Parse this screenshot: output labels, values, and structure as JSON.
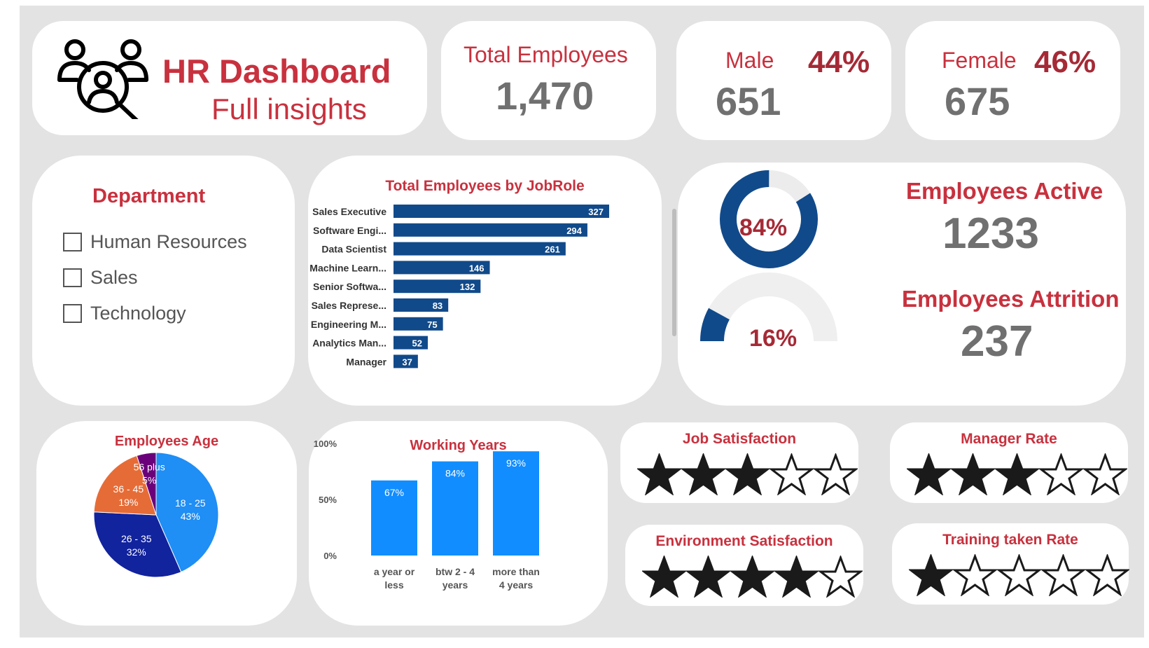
{
  "header": {
    "title": "HR Dashboard",
    "subtitle": "Full insights",
    "logo_icon": "team-search-icon"
  },
  "kpis": {
    "total": {
      "label": "Total Employees",
      "value": "1,470"
    },
    "male": {
      "label": "Male",
      "value": "651",
      "pct": "44%"
    },
    "female": {
      "label": "Female",
      "value": "675",
      "pct": "46%"
    }
  },
  "department": {
    "title": "Department",
    "items": [
      {
        "label": "Human Resources",
        "checked": false
      },
      {
        "label": "Sales",
        "checked": false
      },
      {
        "label": "Technology",
        "checked": false
      }
    ]
  },
  "status": {
    "active_label": "Employees Active",
    "active_value": "1233",
    "attrition_label": "Employees Attrition",
    "attrition_value": "237",
    "active_pct_label": "84%",
    "attrition_pct_label": "16%",
    "active_fraction": 0.84,
    "attrition_fraction": 0.16
  },
  "ratings": {
    "job_satisfaction": {
      "title": "Job Satisfaction",
      "stars": 3,
      "max": 5
    },
    "manager_rate": {
      "title": "Manager Rate",
      "stars": 3,
      "max": 5
    },
    "environment_satisfaction": {
      "title": "Environment Satisfaction",
      "stars": 4,
      "max": 5
    },
    "training_taken_rate": {
      "title": "Training taken Rate",
      "stars": 1,
      "max": 5
    }
  },
  "colors": {
    "accent_red": "#c8313e",
    "dark_red": "#a52a36",
    "bar_navy": "#114a8a",
    "bar_blue": "#118dff",
    "pie_light_blue": "#1f8ef5",
    "pie_navy": "#12239e",
    "pie_orange": "#e66c37",
    "pie_purple": "#6b007b",
    "kpi_grey": "#707070"
  },
  "chart_data": [
    {
      "type": "bar",
      "orientation": "horizontal",
      "title": "Total Employees by JobRole",
      "categories": [
        "Sales Executive",
        "Software Engi...",
        "Data Scientist",
        "Machine Learn...",
        "Senior Softwa...",
        "Sales Represe...",
        "Engineering M...",
        "Analytics Man...",
        "Manager"
      ],
      "values": [
        327,
        294,
        261,
        146,
        132,
        83,
        75,
        52,
        37
      ],
      "data_labels": true
    },
    {
      "type": "pie",
      "title": "Employees Age",
      "categories": [
        "18 - 25",
        "26 - 35",
        "36 - 45",
        "56 plus"
      ],
      "values": [
        43,
        32,
        19,
        5
      ],
      "labels": [
        "43%",
        "32%",
        "19%",
        "5%"
      ]
    },
    {
      "type": "bar",
      "title": "Working Years",
      "categories": [
        "a year or less",
        "btw 2 - 4 years",
        "more than 4 years"
      ],
      "category_lines": [
        [
          "a year or",
          "less"
        ],
        [
          "btw 2 - 4",
          "years"
        ],
        [
          "more than",
          "4 years"
        ]
      ],
      "values": [
        67,
        84,
        93
      ],
      "labels": [
        "67%",
        "84%",
        "93%"
      ],
      "ylim": [
        0,
        100
      ],
      "yticks": [
        "0%",
        "50%",
        "100%"
      ]
    }
  ]
}
